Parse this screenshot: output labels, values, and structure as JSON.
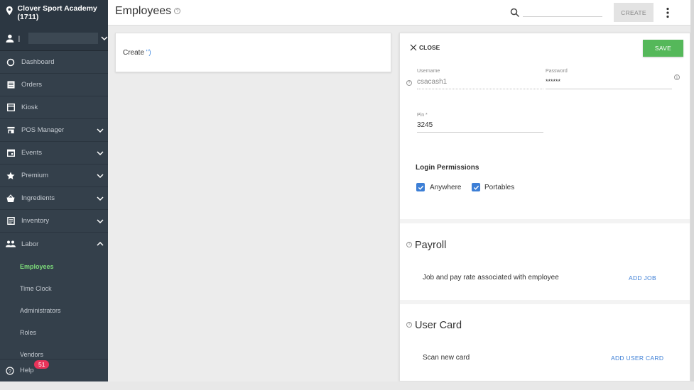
{
  "sidebar": {
    "org_name": "Clover Sport Academy (1711)",
    "user_value": "|",
    "items": [
      {
        "label": "Dashboard",
        "icon": "dashboard-icon"
      },
      {
        "label": "Orders",
        "icon": "orders-icon"
      },
      {
        "label": "Kiosk",
        "icon": "kiosk-icon"
      },
      {
        "label": "POS Manager",
        "icon": "store-icon"
      },
      {
        "label": "Events",
        "icon": "calendar-icon"
      },
      {
        "label": "Premium",
        "icon": "star-icon"
      },
      {
        "label": "Ingredients",
        "icon": "basket-icon"
      },
      {
        "label": "Inventory",
        "icon": "clipboard-icon"
      },
      {
        "label": "Labor",
        "icon": "people-icon"
      }
    ],
    "labor_sub": [
      "Employees",
      "Time Clock",
      "Administrators",
      "Roles",
      "Vendors"
    ],
    "help_label": "Help",
    "help_badge": "51"
  },
  "header": {
    "title": "Employees",
    "create_label": "CREATE"
  },
  "create_card": {
    "text": "Create",
    "quote": "\")"
  },
  "panel": {
    "close_label": "CLOSE",
    "save_label": "SAVE",
    "username_label": "Username",
    "username_value": "csacash1",
    "password_label": "Password",
    "password_value": "******",
    "pin_label": "Pin *",
    "pin_value": "3245",
    "permissions_title": "Login Permissions",
    "perm_anywhere": "Anywhere",
    "perm_portables": "Portables",
    "payroll_title": "Payroll",
    "payroll_desc": "Job and pay rate associated with employee",
    "add_job": "ADD JOB",
    "usercard_title": "User Card",
    "usercard_desc": "Scan new card",
    "add_user_card": "ADD USER CARD"
  },
  "colors": {
    "sidebar_bg": "#34404b",
    "active_green": "#7ddc7a",
    "save_green": "#55b85a",
    "link_blue": "#3d7fd6",
    "badge_red": "#e8335a"
  }
}
